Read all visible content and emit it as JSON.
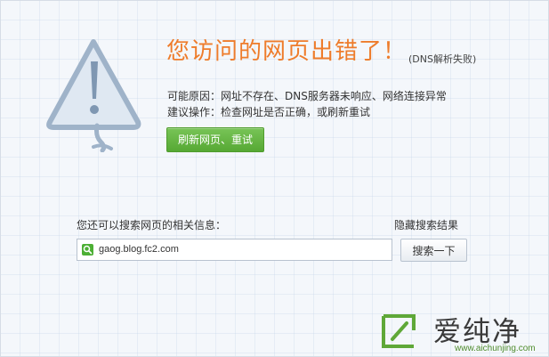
{
  "error": {
    "title": "您访问的网页出错了！",
    "detail": "(DNS解析失败)",
    "reason_line": "可能原因：网址不存在、DNS服务器未响应、网络连接异常",
    "advice_line": "建议操作：检查网址是否正确，或刷新重试",
    "refresh_button_label": "刷新网页、重试",
    "illustration_icon": "warning-triangle-icon"
  },
  "search": {
    "hint": "您还可以搜索网页的相关信息：",
    "hide_results_label": "隐藏搜索结果",
    "query": "gaog.blog.fc2.com",
    "button_label": "搜索一下",
    "engine_icon": "search-engine-icon"
  },
  "watermark": {
    "name": "爱纯净",
    "url": "www.aichunjing.com"
  },
  "colors": {
    "title": "#ee7c2b",
    "refresh_button": "#5fb13c",
    "watermark_green": "#4f8c2d",
    "background": "#f4f7fb"
  }
}
